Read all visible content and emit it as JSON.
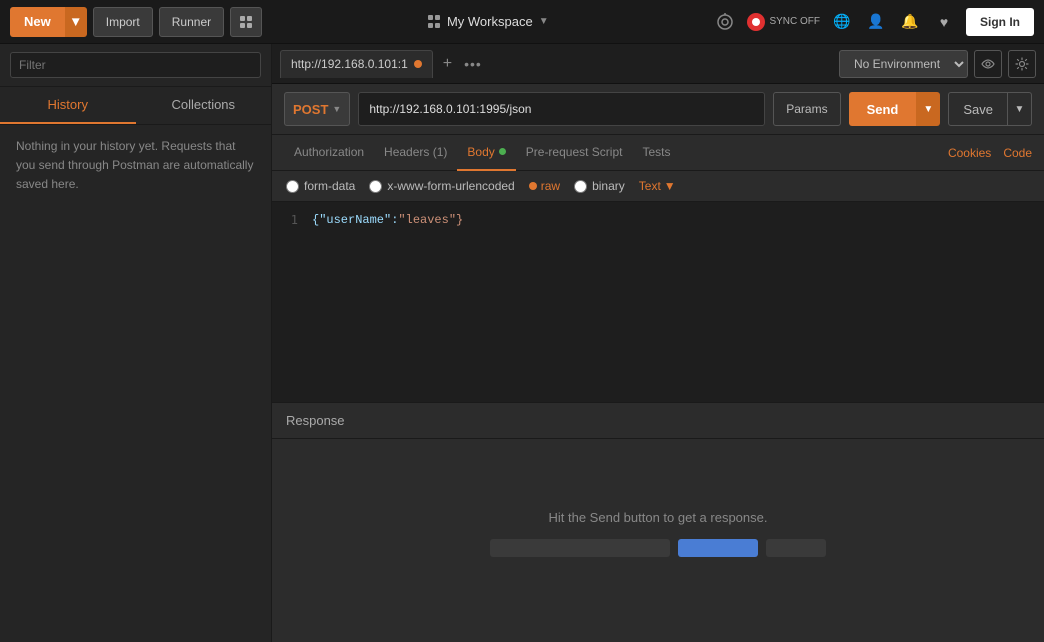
{
  "topnav": {
    "new_label": "New",
    "import_label": "Import",
    "runner_label": "Runner",
    "workspace_label": "My Workspace",
    "sync_label": "SYNC OFF",
    "signin_label": "Sign In"
  },
  "sidebar": {
    "filter_placeholder": "Filter",
    "tabs": [
      {
        "id": "history",
        "label": "History"
      },
      {
        "id": "collections",
        "label": "Collections"
      }
    ],
    "history_empty_text": "Nothing in your history yet. Requests that you send through Postman are automatically saved here."
  },
  "request_tab": {
    "url_short": "http://192.168.0.101:1",
    "url_full": "http://192.168.0.101:1995/json"
  },
  "environment": {
    "label": "No Environment",
    "options": [
      "No Environment"
    ]
  },
  "request": {
    "method": "POST",
    "url": "http://192.168.0.101:1995/json",
    "params_label": "Params",
    "send_label": "Send",
    "save_label": "Save"
  },
  "body_tabs": [
    {
      "id": "authorization",
      "label": "Authorization",
      "active": false
    },
    {
      "id": "headers",
      "label": "Headers (1)",
      "active": false
    },
    {
      "id": "body",
      "label": "Body",
      "active": true
    },
    {
      "id": "prerequest",
      "label": "Pre-request Script",
      "active": false
    },
    {
      "id": "tests",
      "label": "Tests",
      "active": false
    }
  ],
  "body_links": {
    "cookies": "Cookies",
    "code": "Code"
  },
  "body_radio": {
    "form_data": "form-data",
    "urlencoded": "x-www-form-urlencoded",
    "raw": "raw",
    "binary": "binary",
    "text_type": "Text"
  },
  "code_editor": {
    "lines": [
      {
        "num": 1,
        "content": "{\"userName\":\"leaves\"}"
      }
    ]
  },
  "response": {
    "label": "Response",
    "empty_message": "Hit the Send button to get a response."
  }
}
